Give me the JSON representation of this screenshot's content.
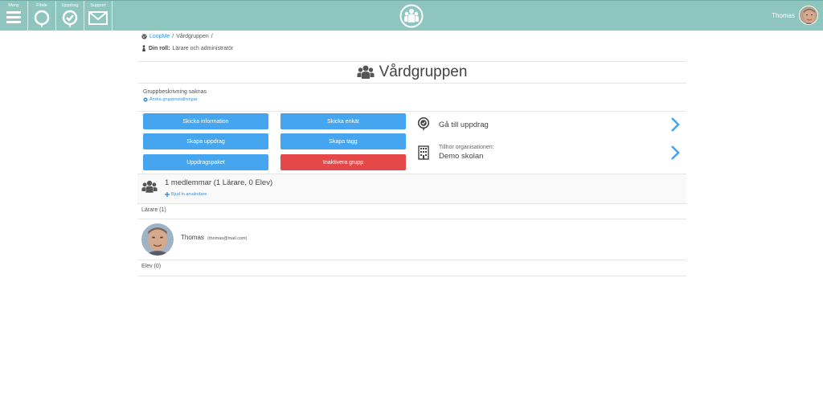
{
  "nav": {
    "items": [
      {
        "label": "Meny",
        "icon": "hamburger-icon"
      },
      {
        "label": "Flöde",
        "icon": "speech-bubble-icon"
      },
      {
        "label": "Uppdrag",
        "icon": "mission-check-icon"
      },
      {
        "label": "Support",
        "icon": "envelope-icon"
      }
    ]
  },
  "user": {
    "name": "Thomas"
  },
  "breadcrumb": {
    "root": "LoopMe",
    "sep1": "/",
    "current": "Vårdgruppen",
    "sep2": "/"
  },
  "role": {
    "label": "Din roll:",
    "value": "Lärare och administratör"
  },
  "group": {
    "title": "Vårdgruppen",
    "description": "Gruppbeskrivning saknas",
    "settings_link": "Ändra gruppinställningar"
  },
  "actions": {
    "send_info": "Skicka information",
    "send_survey": "Skicka enkät",
    "create_mission": "Skapa uppdrag",
    "create_tag": "Skapa tagg",
    "mission_package": "Uppdragspaket",
    "deactivate_group": "Inaktivera grupp"
  },
  "side": {
    "goto_missions": "Gå till uppdrag",
    "org_label": "Tillhör organisationen:",
    "org_name": "Demo skolan"
  },
  "members": {
    "summary": "1 medlemmar (1 Lärare, 0 Elev)",
    "invite": "Bjud in användare",
    "teachers_header": "Lärare (1)",
    "students_header": "Elev (0)",
    "teachers": [
      {
        "name": "Thomas",
        "email": "(thomas@mail.com)"
      }
    ]
  },
  "colors": {
    "topbar": "#8fc5bf",
    "primary_button": "#45a6ef",
    "danger_button": "#e54848",
    "link": "#3b8fd8"
  }
}
